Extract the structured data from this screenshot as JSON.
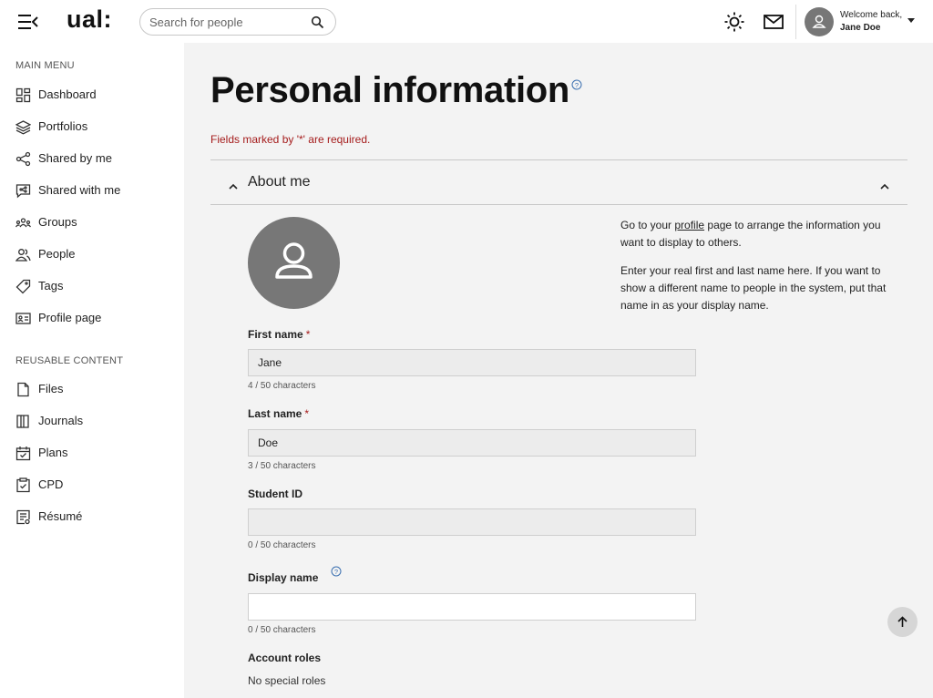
{
  "header": {
    "logo": "ual:",
    "search": {
      "placeholder": "Search for people"
    },
    "welcome": "Welcome back,",
    "user_name": "Jane Doe"
  },
  "sidebar": {
    "main_heading": "MAIN MENU",
    "main_items": [
      {
        "label": "Dashboard",
        "icon": "dashboard-icon"
      },
      {
        "label": "Portfolios",
        "icon": "layers-icon"
      },
      {
        "label": "Shared by me",
        "icon": "share-icon"
      },
      {
        "label": "Shared with me",
        "icon": "shared-with-me-icon"
      },
      {
        "label": "Groups",
        "icon": "groups-icon"
      },
      {
        "label": "People",
        "icon": "people-icon"
      },
      {
        "label": "Tags",
        "icon": "tag-icon"
      },
      {
        "label": "Profile page",
        "icon": "profile-card-icon"
      }
    ],
    "content_heading": "REUSABLE CONTENT",
    "content_items": [
      {
        "label": "Files",
        "icon": "file-icon"
      },
      {
        "label": "Journals",
        "icon": "journal-icon"
      },
      {
        "label": "Plans",
        "icon": "calendar-check-icon"
      },
      {
        "label": "CPD",
        "icon": "clipboard-check-icon"
      },
      {
        "label": "Résumé",
        "icon": "resume-icon"
      }
    ]
  },
  "main": {
    "title": "Personal information",
    "required_note": "Fields marked by '*' are required.",
    "section_title": "About me",
    "info": {
      "p1_before": "Go to your ",
      "p1_link": "profile",
      "p1_after": " page to arrange the information you want to display to others.",
      "p2": "Enter your real first and last name here. If you want to show a different name to people in the system, put that name in as your display name."
    },
    "fields": {
      "first_name": {
        "label": "First name",
        "required_mark": "*",
        "value": "Jane",
        "count": "4 / 50 characters"
      },
      "last_name": {
        "label": "Last name",
        "required_mark": "*",
        "value": "Doe",
        "count": "3 / 50 characters"
      },
      "student_id": {
        "label": "Student ID",
        "value": "",
        "count": "0 / 50 characters"
      },
      "display_name": {
        "label": "Display name",
        "value": "",
        "count": "0 / 50 characters"
      }
    },
    "account_roles": {
      "label": "Account roles",
      "value": "No special roles"
    }
  },
  "colors": {
    "accent_required": "#a51c1c",
    "main_background": "#f3f3f3",
    "avatar_gray": "#777777",
    "help_blue": "#3a6fb0"
  }
}
